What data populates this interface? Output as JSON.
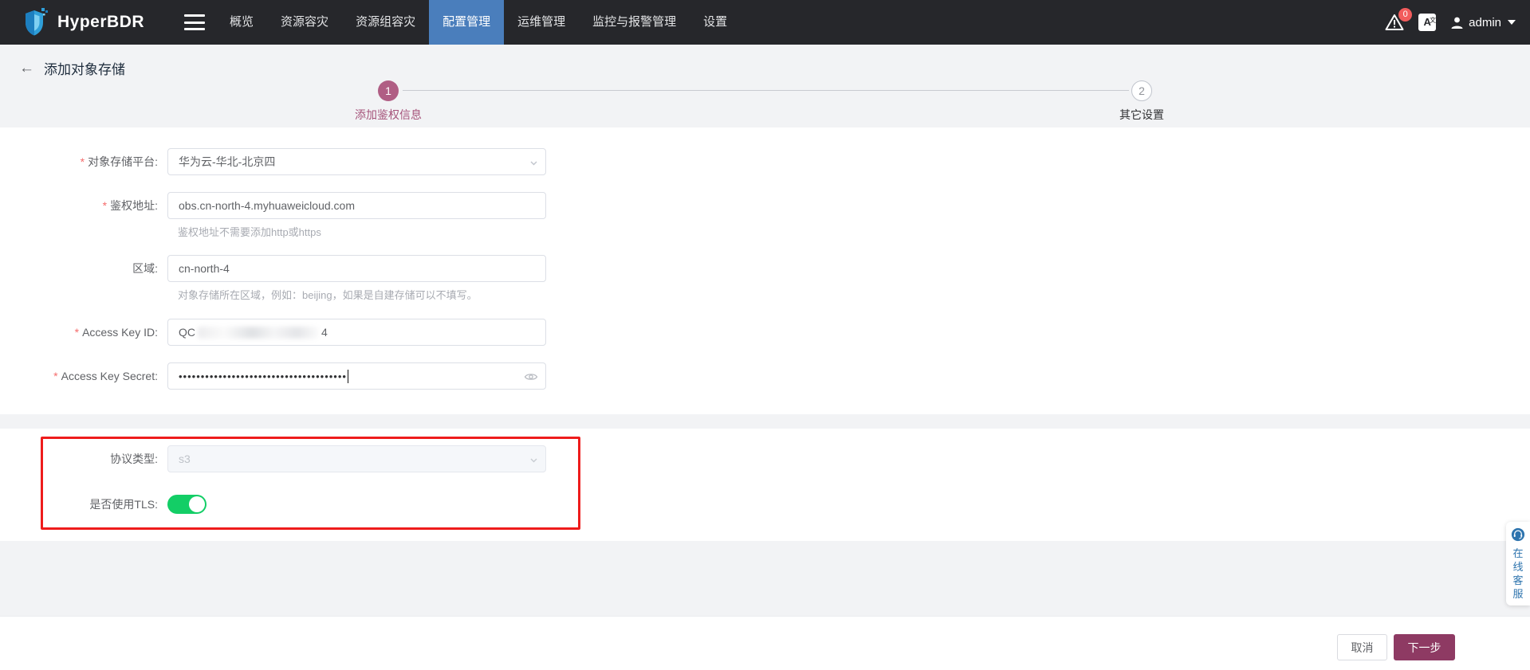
{
  "header": {
    "brand": "HyperBDR",
    "nav": [
      {
        "label": "概览",
        "active": false
      },
      {
        "label": "资源容灾",
        "active": false
      },
      {
        "label": "资源组容灾",
        "active": false
      },
      {
        "label": "配置管理",
        "active": true
      },
      {
        "label": "运维管理",
        "active": false
      },
      {
        "label": "监控与报警管理",
        "active": false
      },
      {
        "label": "设置",
        "active": false
      }
    ],
    "alert_count": "0",
    "language_icon_text": "A",
    "language_icon_sub": "文",
    "user": "admin"
  },
  "page": {
    "back_icon": "←",
    "title": "添加对象存储"
  },
  "steps": [
    {
      "number": "1",
      "label": "添加鉴权信息",
      "state": "active"
    },
    {
      "number": "2",
      "label": "其它设置",
      "state": "pending"
    }
  ],
  "form": {
    "required_mark": "*",
    "platform": {
      "label": "对象存储平台:",
      "value": "华为云-华北-北京四",
      "type": "select"
    },
    "auth_address": {
      "label": "鉴权地址:",
      "value": "obs.cn-north-4.myhuaweicloud.com",
      "help": "鉴权地址不需要添加http或https"
    },
    "region": {
      "label": "区域:",
      "value": "cn-north-4",
      "help": "对象存储所在区域，例如：beijing，如果是自建存储可以不填写。"
    },
    "access_key_id": {
      "label": "Access Key ID:",
      "value_prefix": "QC",
      "value_redacted": true,
      "value_suffix": "4"
    },
    "access_key_secret": {
      "label": "Access Key Secret:",
      "masked_value": "••••••••••••••••••••••••••••••••••••••"
    },
    "protocol": {
      "label": "协议类型:",
      "value": "s3",
      "disabled": true,
      "type": "select"
    },
    "tls": {
      "label": "是否使用TLS:",
      "enabled": true
    }
  },
  "footer": {
    "cancel_label": "取消",
    "next_label": "下一步"
  },
  "support_widget": {
    "label": "在线客服"
  },
  "colors": {
    "nav_active": "#4a7ebc",
    "step_active": "#b05e84",
    "accent_button": "#8e3a63",
    "toggle_on": "#13ce66",
    "annotation_red": "#ee1c1c",
    "badge_red": "#f25c5c"
  }
}
